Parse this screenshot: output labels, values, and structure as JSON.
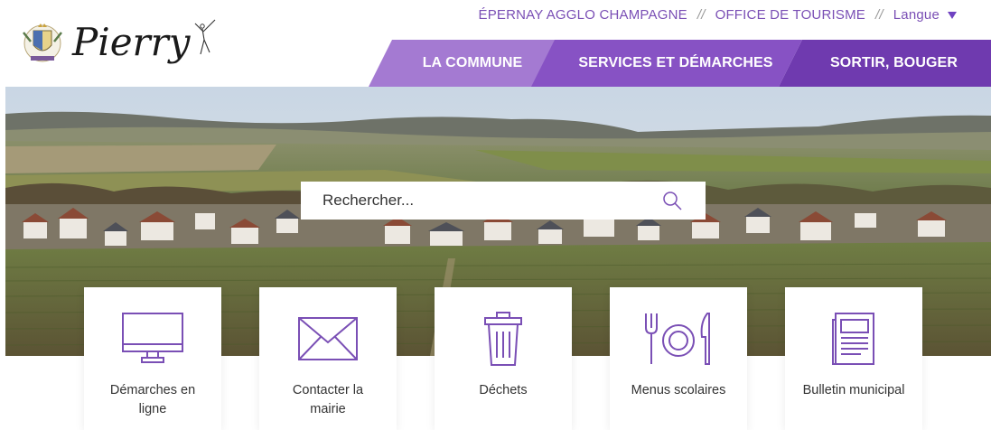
{
  "brand": {
    "name": "Pierry",
    "crest_icon": "town-crest-icon",
    "dancer_icon": "dancer-figure-icon"
  },
  "top_links": {
    "agglo": "ÉPERNAY AGGLO CHAMPAGNE",
    "separator": "//",
    "tourism": "OFFICE DE TOURISME",
    "language": "Langue"
  },
  "nav": {
    "items": [
      {
        "label": "LA COMMUNE",
        "color": "#a47ad2"
      },
      {
        "label": "SERVICES ET DÉMARCHES",
        "color": "#8752c4"
      },
      {
        "label": "SORTIR, BOUGER",
        "color": "#6f3aaf"
      }
    ]
  },
  "search": {
    "placeholder": "Rechercher...",
    "icon": "search-icon"
  },
  "quick_links": [
    {
      "label": "Démarches en ligne",
      "icon": "monitor-icon"
    },
    {
      "label": "Contacter la mairie",
      "icon": "envelope-icon"
    },
    {
      "label": "Déchets",
      "icon": "trash-bin-icon"
    },
    {
      "label": "Menus scolaires",
      "icon": "fork-plate-knife-icon"
    },
    {
      "label": "Bulletin municipal",
      "icon": "newspaper-icon"
    }
  ],
  "colors": {
    "accent": "#8752c4",
    "icon_stroke": "#7a4fb5"
  }
}
